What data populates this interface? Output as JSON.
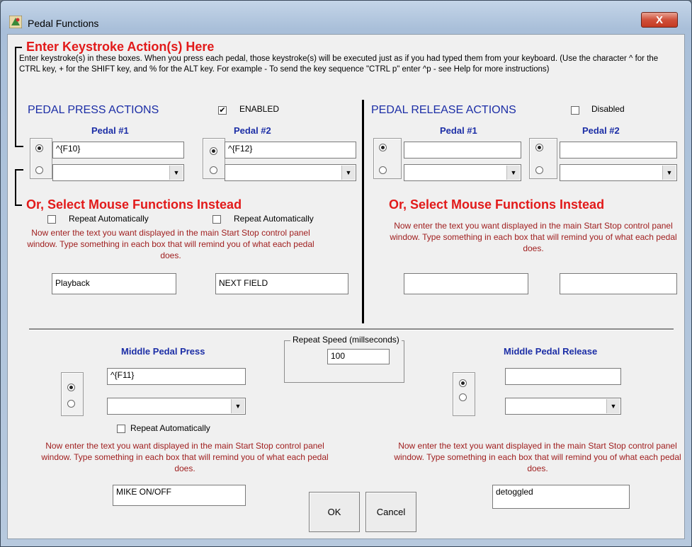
{
  "window": {
    "title": "Pedal Functions",
    "close_label": "X"
  },
  "keystroke": {
    "heading": "Enter Keystroke Action(s) Here",
    "instructions": "Enter keystroke(s) in these boxes. When you press each pedal, those keystroke(s) will be executed just as if you had typed them from your keyboard.  (Use the character ^ for the CTRL key, + for the SHIFT key, and % for the ALT key. For example - To send the key sequence \"CTRL p\" enter ^p - see Help for more instructions)"
  },
  "press": {
    "heading": "PEDAL PRESS ACTIONS",
    "enabled_label": "ENABLED",
    "enabled_checked": true,
    "pedal1_label": "Pedal #1",
    "pedal2_label": "Pedal #2",
    "pedal1_keys": "^{F10}",
    "pedal2_keys": "^{F12}",
    "mouse_heading": "Or, Select  Mouse Functions Instead",
    "repeat_label_1": "Repeat Automatically",
    "repeat_label_2": "Repeat Automatically",
    "display_text_1": "Playback",
    "display_text_2": "NEXT FIELD"
  },
  "release": {
    "heading": "PEDAL RELEASE ACTIONS",
    "disabled_label": "Disabled",
    "pedal1_label": "Pedal #1",
    "pedal2_label": "Pedal #2",
    "pedal1_keys": "",
    "pedal2_keys": "",
    "mouse_heading": "Or, Select  Mouse Functions Instead",
    "display_text_1": "",
    "display_text_2": ""
  },
  "display_instructions": "Now enter the text you want displayed in the main Start Stop control panel window.  Type something in each box that will remind you of what each pedal does.",
  "middle": {
    "press_heading": "Middle Pedal Press",
    "press_keys": "^{F11}",
    "press_repeat_label": "Repeat Automatically",
    "press_display": "MIKE ON/OFF",
    "release_heading": "Middle Pedal Release",
    "release_keys": "",
    "release_display": "detoggled",
    "repeat_speed_label": "Repeat Speed (millseconds)",
    "repeat_speed_value": "100"
  },
  "buttons": {
    "ok": "OK",
    "cancel": "Cancel"
  }
}
